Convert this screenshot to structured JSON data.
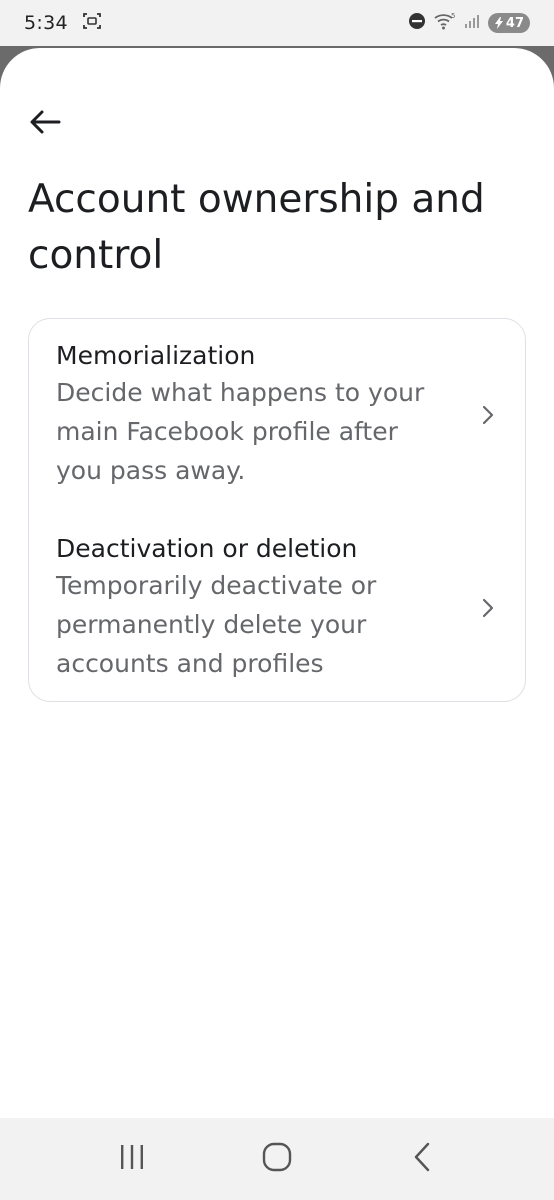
{
  "status_bar": {
    "time": "5:34",
    "battery": "47",
    "icons": [
      "screenshot-icon",
      "do-not-disturb-icon",
      "wifi-icon",
      "signal-icon",
      "battery-icon"
    ]
  },
  "header": {
    "back_icon": "arrow-left-icon",
    "title": "Account ownership and control"
  },
  "options": [
    {
      "title": "Memorialization",
      "description": "Decide what happens to your main Facebook profile after you pass away.",
      "icon": "chevron-right-icon"
    },
    {
      "title": "Deactivation or deletion",
      "description": "Temporarily deactivate or permanently delete your accounts and profiles",
      "icon": "chevron-right-icon"
    }
  ],
  "nav_bar": {
    "icons": [
      "recent-apps-icon",
      "home-icon",
      "back-icon"
    ]
  },
  "colors": {
    "title": "#1c1e21",
    "secondary_text": "#65676b",
    "card_border": "#dde0e4",
    "status_bar": "#f2f2f2"
  }
}
